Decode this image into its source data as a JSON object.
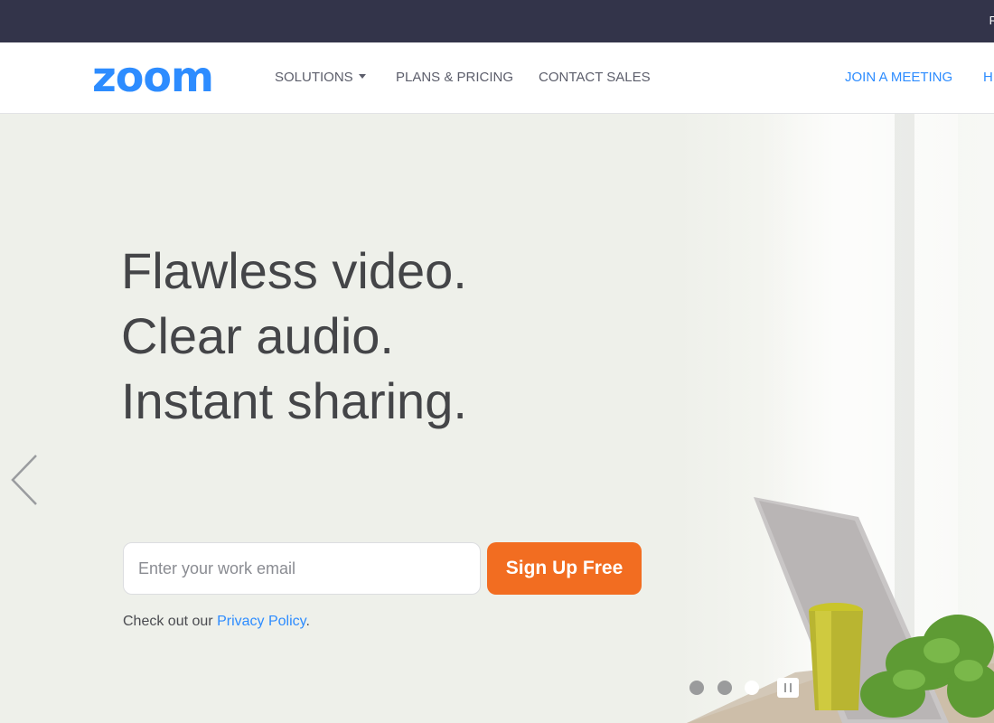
{
  "topbar": {
    "text": "R"
  },
  "nav": {
    "logo": "zoom",
    "links": [
      {
        "label": "SOLUTIONS"
      },
      {
        "label": "PLANS & PRICING"
      },
      {
        "label": "CONTACT SALES"
      }
    ],
    "join_meeting": "JOIN A MEETING",
    "host_partial": "H"
  },
  "hero": {
    "headline": [
      "Flawless video.",
      "Clear audio.",
      "Instant sharing."
    ],
    "email_placeholder": "Enter your work email",
    "signup_label": "Sign Up Free",
    "privacy_prefix": "Check out our ",
    "privacy_link": "Privacy Policy",
    "privacy_suffix": "."
  },
  "carousel": {
    "slide_count": 3,
    "active_slide": 3
  },
  "icons": {
    "prev": "chevron-left-icon",
    "caret": "caret-down-icon",
    "pause": "pause-icon"
  },
  "colors": {
    "brand_blue": "#2d8cff",
    "cta_orange": "#f26d21",
    "topbar": "#33344a",
    "hero_bg": "#eef0ea",
    "headline": "#444548"
  }
}
